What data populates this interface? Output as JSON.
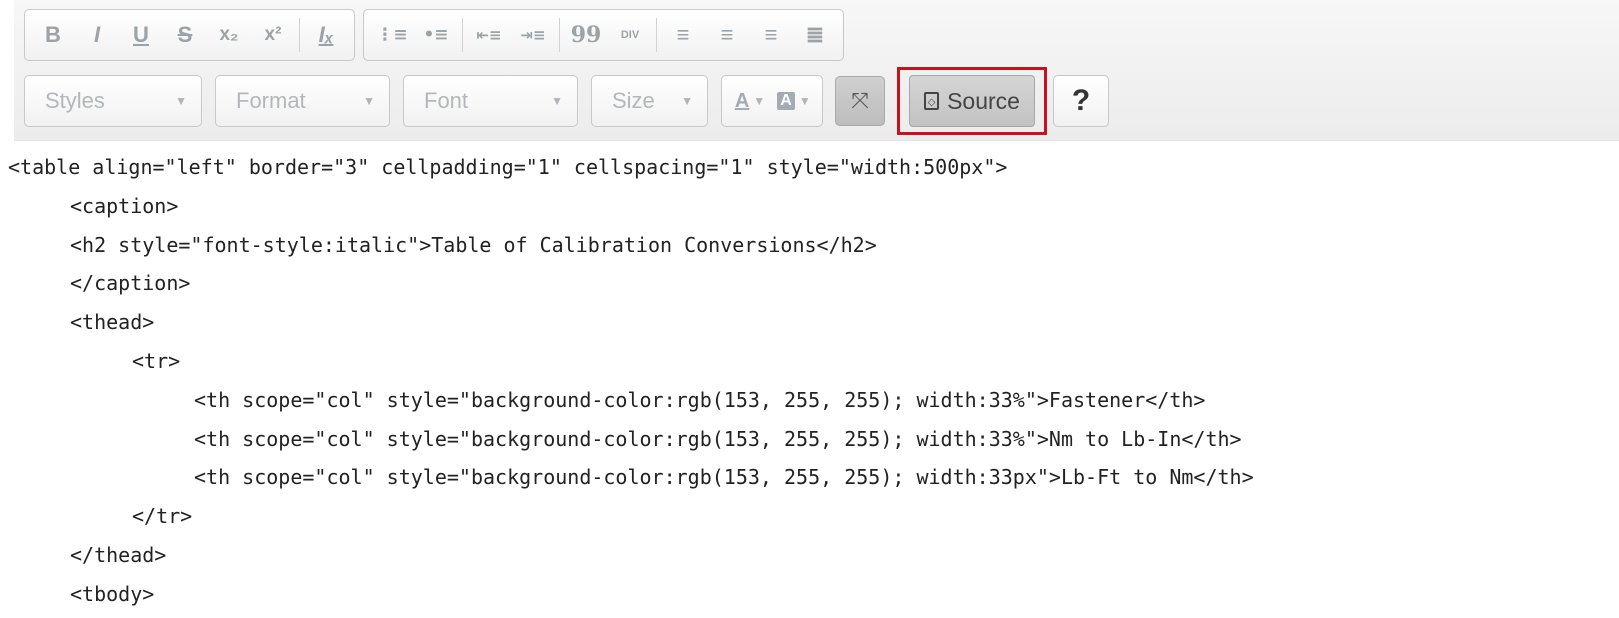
{
  "toolbar": {
    "basic_styles": [
      {
        "icon": "bold-icon",
        "glyph": "B"
      },
      {
        "icon": "italic-icon",
        "glyph": "I"
      },
      {
        "icon": "underline-icon",
        "glyph": "U"
      },
      {
        "icon": "strikethrough-icon",
        "glyph": "S"
      },
      {
        "icon": "subscript-icon",
        "glyph": "x₂"
      },
      {
        "icon": "superscript-icon",
        "glyph": "x²"
      },
      {
        "icon": "remove-format-icon",
        "glyph": "Iₓ"
      }
    ],
    "paragraph": [
      {
        "icon": "numbered-list-icon",
        "glyph": "⋮≡"
      },
      {
        "icon": "bulleted-list-icon",
        "glyph": "•≡"
      },
      {
        "icon": "decrease-indent-icon",
        "glyph": "⇤≡"
      },
      {
        "icon": "increase-indent-icon",
        "glyph": "⇥≡"
      },
      {
        "icon": "blockquote-icon",
        "glyph": "99"
      },
      {
        "icon": "div-container-icon",
        "glyph": "DIV"
      },
      {
        "icon": "align-left-icon",
        "glyph": "≡"
      },
      {
        "icon": "align-center-icon",
        "glyph": "≡"
      },
      {
        "icon": "align-right-icon",
        "glyph": "≡"
      },
      {
        "icon": "justify-icon",
        "glyph": "≣"
      }
    ],
    "combos": [
      {
        "name": "styles-combo",
        "label": "Styles"
      },
      {
        "name": "format-combo",
        "label": "Format"
      },
      {
        "name": "font-combo",
        "label": "Font"
      },
      {
        "name": "size-combo",
        "label": "Size"
      }
    ],
    "text_color_glyph": "A",
    "bg_color_glyph": "A",
    "maximize_glyph": "⤧",
    "source_label": "Source",
    "help_label": "?",
    "highlight_color": "#c8111c"
  },
  "source_code": [
    {
      "indent": 0,
      "text": "<table align=\"left\" border=\"3\" cellpadding=\"1\" cellspacing=\"1\" style=\"width:500px\">"
    },
    {
      "indent": 1,
      "text": "<caption>"
    },
    {
      "indent": 1,
      "text": "<h2 style=\"font-style:italic\">Table of Calibration Conversions</h2>"
    },
    {
      "indent": 1,
      "text": "</caption>"
    },
    {
      "indent": 1,
      "text": "<thead>"
    },
    {
      "indent": 2,
      "text": "<tr>"
    },
    {
      "indent": 3,
      "text": "<th scope=\"col\" style=\"background-color:rgb(153, 255, 255); width:33%\">Fastener</th>"
    },
    {
      "indent": 3,
      "text": "<th scope=\"col\" style=\"background-color:rgb(153, 255, 255); width:33%\">Nm to Lb-In</th>"
    },
    {
      "indent": 3,
      "text": "<th scope=\"col\" style=\"background-color:rgb(153, 255, 255); width:33px\">Lb-Ft to Nm</th>"
    },
    {
      "indent": 2,
      "text": "</tr>"
    },
    {
      "indent": 1,
      "text": "</thead>"
    },
    {
      "indent": 1,
      "text": "<tbody>"
    }
  ]
}
